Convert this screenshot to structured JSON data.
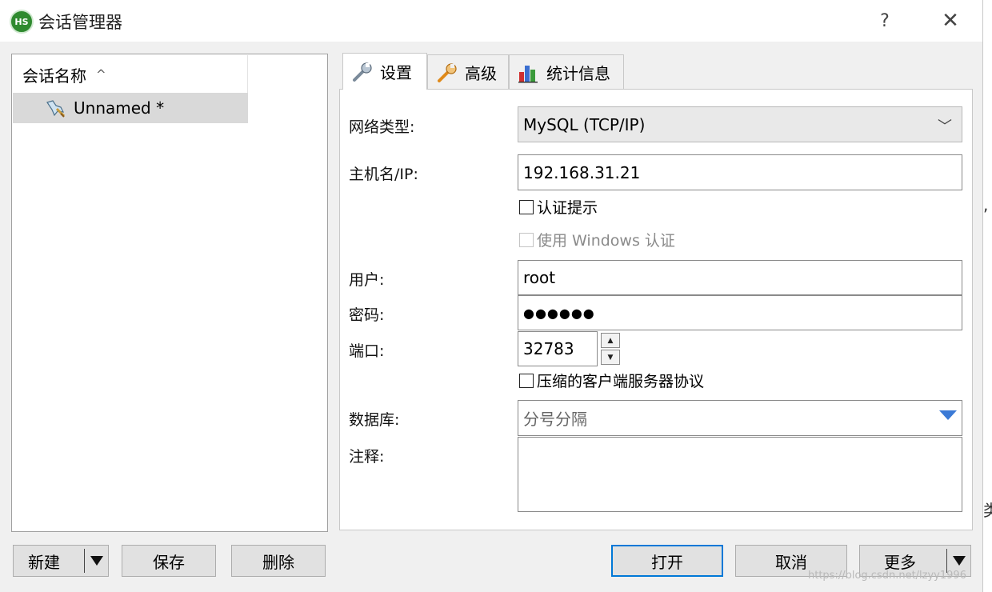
{
  "window": {
    "title": "会话管理器",
    "app_icon_text": "HS",
    "help": "?",
    "close": "✕"
  },
  "session_list": {
    "header": "会话名称",
    "sort_indicator": "^",
    "items": [
      {
        "name": "Unnamed *",
        "selected": true
      }
    ]
  },
  "tabs": [
    {
      "label": "设置",
      "icon": "wrench-icon",
      "active": true
    },
    {
      "label": "高级",
      "icon": "wrench-icon",
      "active": false
    },
    {
      "label": "统计信息",
      "icon": "bar-chart-icon",
      "active": false
    }
  ],
  "settings": {
    "network_type": {
      "label": "网络类型:",
      "value": "MySQL (TCP/IP)"
    },
    "host": {
      "label": "主机名/IP:",
      "value": "192.168.31.21"
    },
    "auth_prompt": {
      "label": "认证提示",
      "checked": false
    },
    "windows_auth": {
      "label": "使用 Windows 认证",
      "checked": false,
      "disabled": true
    },
    "user": {
      "label": "用户:",
      "value": "root"
    },
    "password": {
      "label": "密码:",
      "value": "●●●●●●"
    },
    "port": {
      "label": "端口:",
      "value": "32783"
    },
    "compress": {
      "label": "压缩的客户端服务器协议",
      "checked": false
    },
    "database": {
      "label": "数据库:",
      "placeholder": "分号分隔"
    },
    "comment": {
      "label": "注释:",
      "value": ""
    }
  },
  "buttons": {
    "new": "新建",
    "save": "保存",
    "delete": "删除",
    "open": "打开",
    "cancel": "取消",
    "more": "更多"
  },
  "watermark": "https://blog.csdn.net/lzyy1996",
  "colors": {
    "accent": "#0078d7",
    "dropdown_arrow": "#3b7ad6",
    "app_icon": "#2f8a2f"
  }
}
